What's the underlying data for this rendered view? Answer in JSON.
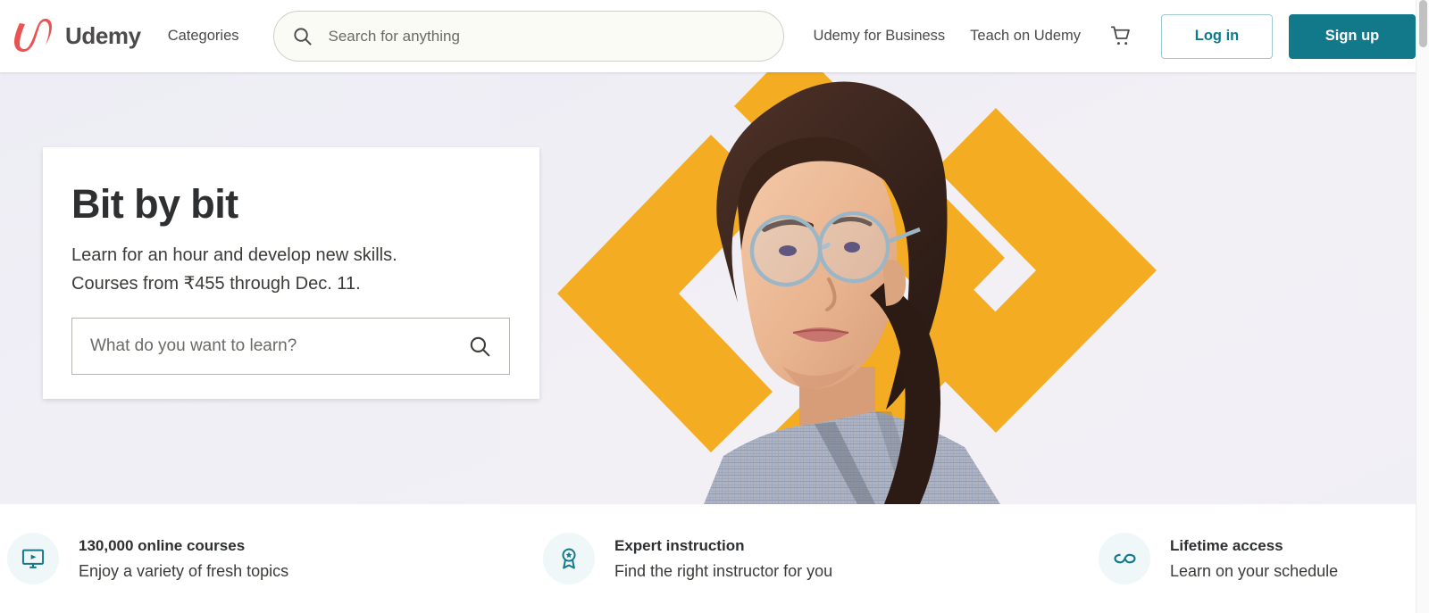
{
  "brand": {
    "name": "Udemy",
    "logo_icon": "udemy-u-swoosh-icon",
    "logo_color": "#eb5252",
    "wordmark_color": "#4c4a4b",
    "accent_teal": "#12798a",
    "accent_yellow": "#f4ac22"
  },
  "header": {
    "categories_label": "Categories",
    "search": {
      "placeholder": "Search for anything",
      "value": "",
      "icon": "search-icon"
    },
    "business_link": "Udemy for Business",
    "teach_link": "Teach on Udemy",
    "cart_icon": "shopping-cart-icon",
    "login_label": "Log in",
    "signup_label": "Sign up"
  },
  "hero": {
    "title": "Bit by bit",
    "subtitle_line1": "Learn for an hour and develop new skills.",
    "subtitle_line2": "Courses from ₹455 through Dec. 11.",
    "search": {
      "placeholder": "What do you want to learn?",
      "value": "",
      "icon": "search-icon"
    },
    "background_image": "woman-with-glasses-photo",
    "decoration": "yellow-chevron-brackets"
  },
  "features": [
    {
      "icon": "monitor-play-icon",
      "title": "130,000 online courses",
      "description": "Enjoy a variety of fresh topics"
    },
    {
      "icon": "award-ribbon-icon",
      "title": "Expert instruction",
      "description": "Find the right instructor for you"
    },
    {
      "icon": "infinity-icon",
      "title": "Lifetime access",
      "description": "Learn on your schedule"
    }
  ],
  "scrollbar": {
    "position_label": "top"
  }
}
